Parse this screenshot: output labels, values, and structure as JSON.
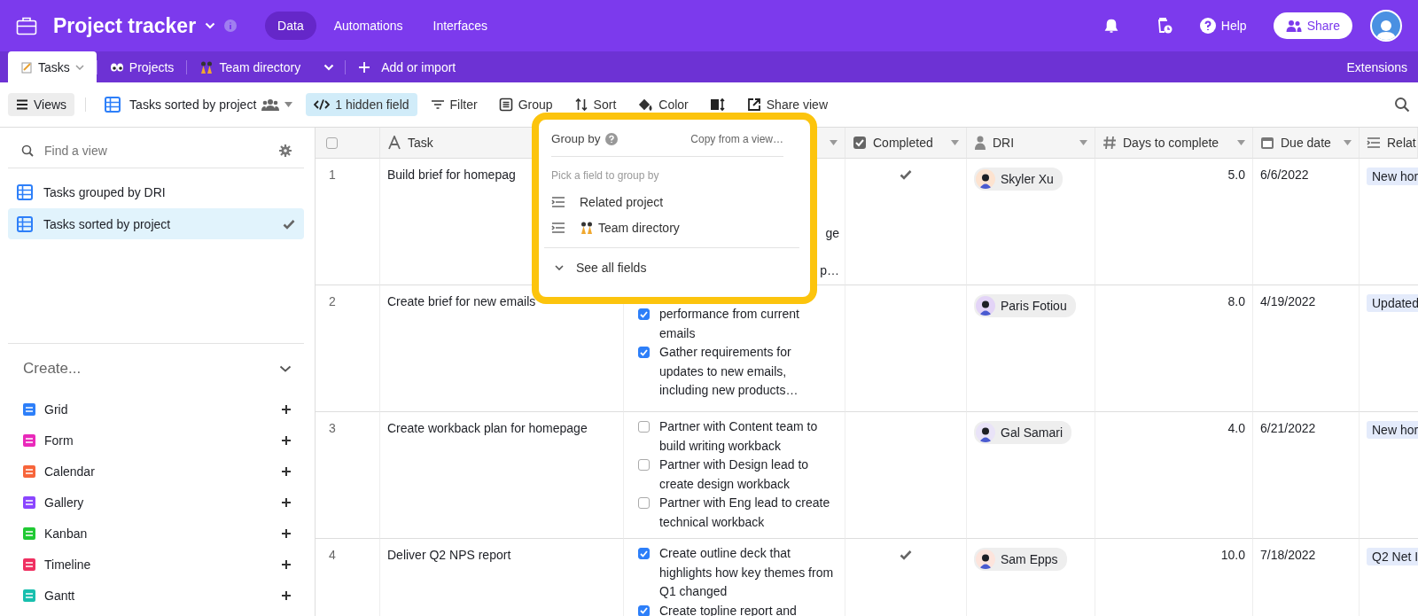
{
  "topbar": {
    "title": "Project tracker",
    "nav": [
      {
        "label": "Data",
        "selected": true
      },
      {
        "label": "Automations",
        "selected": false
      },
      {
        "label": "Interfaces",
        "selected": false
      }
    ],
    "help": "Help",
    "share": "Share"
  },
  "tables_bar": {
    "tabs": [
      {
        "label": "Tasks",
        "selected": true
      },
      {
        "label": "Projects",
        "selected": false
      },
      {
        "label": "Team directory",
        "selected": false
      }
    ],
    "add": "Add or import",
    "extensions": "Extensions"
  },
  "toolbar": {
    "views": "Views",
    "view_name": "Tasks sorted by project",
    "hidden_fields": "1 hidden field",
    "actions": [
      "Filter",
      "Group",
      "Sort",
      "Color"
    ],
    "share_view": "Share view"
  },
  "sidebar": {
    "search": {
      "placeholder": "Find a view"
    },
    "views": [
      {
        "label": "Tasks grouped by DRI",
        "selected": false
      },
      {
        "label": "Tasks sorted by project",
        "selected": true
      }
    ],
    "create_title": "Create...",
    "create_items": [
      {
        "label": "Grid",
        "color": "#2d7ff9"
      },
      {
        "label": "Form",
        "color": "#e929ba"
      },
      {
        "label": "Calendar",
        "color": "#f7653b"
      },
      {
        "label": "Gallery",
        "color": "#8b46ff"
      },
      {
        "label": "Kanban",
        "color": "#20c933"
      },
      {
        "label": "Timeline",
        "color": "#ef3061"
      },
      {
        "label": "Gantt",
        "color": "#18bfae"
      }
    ]
  },
  "grid": {
    "select_all_checked": false,
    "columns": [
      "Task",
      "Completed",
      "DRI",
      "Days to complete",
      "Due date",
      "Relat"
    ],
    "rows": [
      {
        "number": "1",
        "task": "Build brief for homepag",
        "subtask_fragments": [
          "ge",
          "p…"
        ],
        "subtasks": [],
        "completed": true,
        "dri": {
          "name": "Skyler Xu",
          "color": "#fde3d0"
        },
        "days": "5.0",
        "due": "6/6/2022",
        "related": "New hor"
      },
      {
        "number": "2",
        "task": "Create brief for new emails",
        "subtask_fragments": [],
        "subtasks": [
          {
            "text": "performance from current emails",
            "checked": true
          },
          {
            "text": "Gather requirements for updates to new emails, including new products…",
            "checked": true
          }
        ],
        "completed": false,
        "dri": {
          "name": "Paris Fotiou",
          "color": "#e3d4f7"
        },
        "days": "8.0",
        "due": "4/19/2022",
        "related": "Updated"
      },
      {
        "number": "3",
        "task": "Create workback plan for homepage",
        "subtask_fragments": [],
        "subtasks": [
          {
            "text": "Partner with Content team to build writing workback",
            "checked": false
          },
          {
            "text": "Partner with Design lead to create design workback",
            "checked": false
          },
          {
            "text": "Partner with Eng lead to create technical workback",
            "checked": false
          }
        ],
        "completed": false,
        "dri": {
          "name": "Gal Samari",
          "color": "#e9e3f8"
        },
        "days": "4.0",
        "due": "6/21/2022",
        "related": "New hor"
      },
      {
        "number": "4",
        "task": "Deliver Q2 NPS report",
        "subtask_fragments": [],
        "subtasks": [
          {
            "text": "Create outline deck that highlights how key themes from Q1 changed",
            "checked": true
          },
          {
            "text": "Create topline report and",
            "checked": true
          }
        ],
        "completed": true,
        "dri": {
          "name": "Sam Epps",
          "color": "#fde4dc"
        },
        "days": "10.0",
        "due": "7/18/2022",
        "related": "Q2 Net I"
      }
    ]
  },
  "popup": {
    "title": "Group by",
    "copy": "Copy from a view…",
    "hint": "Pick a field to group by",
    "fields": [
      "Related project",
      "Team directory"
    ],
    "see_all": "See all fields"
  }
}
